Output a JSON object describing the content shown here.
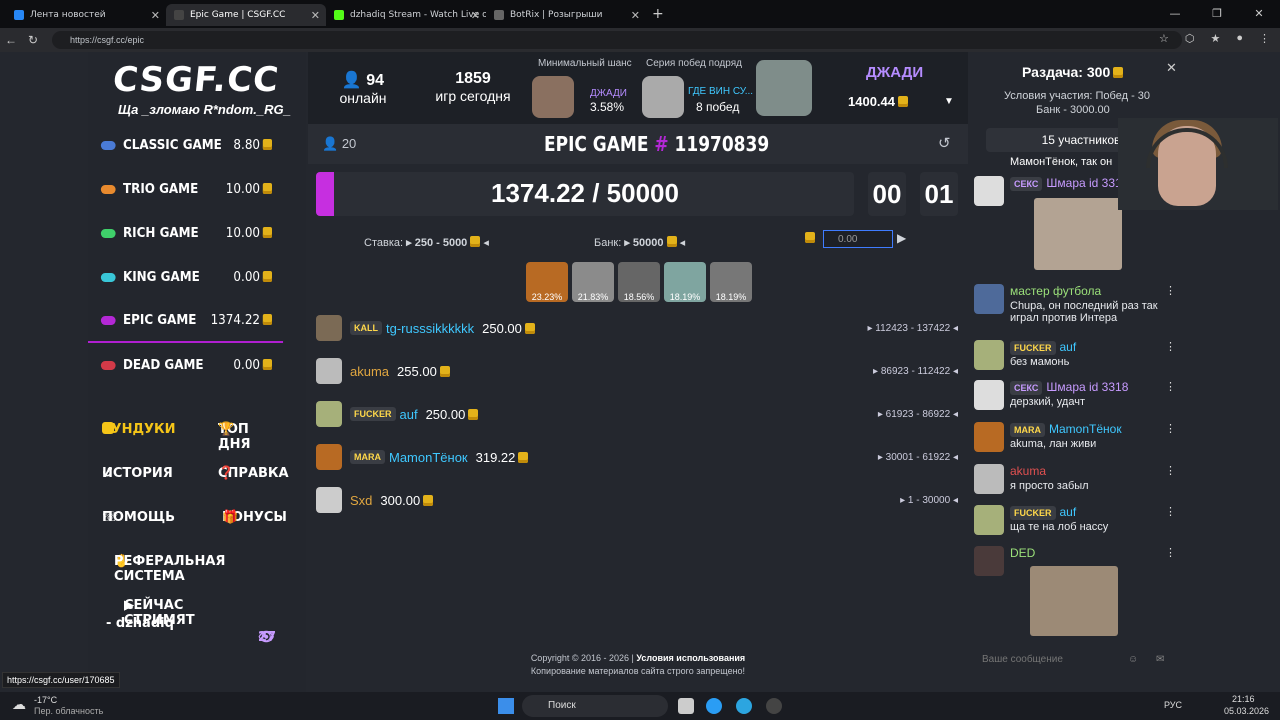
{
  "tabs": [
    {
      "label": "Лента новостей",
      "color": "#2787f5"
    },
    {
      "label": "Epic Game | CSGF.CC",
      "color": "#333"
    },
    {
      "label": "dzhadiq Stream - Watch Live on Ki",
      "color": "#53fc18"
    },
    {
      "label": "BotRix | Розыгрыши",
      "color": "#222"
    }
  ],
  "url": "https://csgf.cc/epic",
  "logo": "CSGF.CC",
  "slogan": "Ща _зломаю R*ndom._RG_",
  "games": [
    {
      "name": "CLASSIC GAME",
      "value": "8.80",
      "color": "#4a7bd6"
    },
    {
      "name": "TRIO GAME",
      "value": "10.00",
      "color": "#e88a2e"
    },
    {
      "name": "RICH GAME",
      "value": "10.00",
      "color": "#3fd06a"
    },
    {
      "name": "KING GAME",
      "value": "0.00",
      "color": "#39c7d8"
    },
    {
      "name": "EPIC GAME",
      "value": "1374.22",
      "color": "#b428d6"
    },
    {
      "name": "DEAD GAME",
      "value": "0.00",
      "color": "#d23a48"
    }
  ],
  "menu": {
    "chests": "СУНДУКИ",
    "top": "ТОП ДНЯ",
    "history": "ИСТОРИЯ",
    "help": "СПРАВКА",
    "support": "ПОМОЩЬ",
    "bonus": "БОНУСЫ",
    "ref": "РЕФЕРАЛЬНАЯ СИСТЕМА",
    "streaming": "СЕЙЧАС СТРИМЯТ",
    "streamer": "- dzhadiq",
    "viewers": "27"
  },
  "header": {
    "online_count": "94",
    "online_label": "онлайн",
    "games_count": "1859",
    "games_label": "игр сегодня",
    "min_chance_label": "Минимальный шанс",
    "min_chance_name": "ДЖАДИ",
    "min_chance_value": "3.58%",
    "streak_label": "Серия побед подряд",
    "streak_name": "ГДЕ ВИН СУ...",
    "streak_value": "8 побед",
    "user_name": "ДЖАДИ",
    "user_balance": "1400.44"
  },
  "game": {
    "players": "20",
    "title_prefix": "EPIC GAME",
    "hash": "#",
    "number": "11970839",
    "pot": "1374.22 / 50000",
    "pot_progress": 0.027,
    "min": "00",
    "sec": "01",
    "bet_label": "Ставка:",
    "bet_range": "250 - 5000",
    "bank_label": "Банк:",
    "bank_value": "50000",
    "input_value": "0.00"
  },
  "chances": [
    "23.23%",
    "21.83%",
    "18.56%",
    "18.19%",
    "18.19%"
  ],
  "players": [
    {
      "tag": "KALL",
      "name": "tg-russsikkkkkk",
      "name_color": "#3fc8ff",
      "amount": "250.00",
      "range": "112423 - 137422",
      "ava": "#7b6a55"
    },
    {
      "tag": "",
      "name": "akuma",
      "name_color": "#e0a640",
      "amount": "255.00",
      "range": "86923 - 112422",
      "ava": "#bbb"
    },
    {
      "tag": "FUCKER",
      "name": "auf",
      "name_color": "#3fc8ff",
      "amount": "250.00",
      "range": "61923 - 86922",
      "ava": "#a6b07a"
    },
    {
      "tag": "MARA",
      "name": "МamonТёнок",
      "name_color": "#3fc8ff",
      "amount": "319.22",
      "range": "30001 - 61922",
      "ava": "#b86a23"
    },
    {
      "tag": "",
      "name": "Sxd",
      "name_color": "#e0a640",
      "amount": "300.00",
      "range": "1 - 30000",
      "ava": "#ccc"
    }
  ],
  "footer": {
    "copyright": "Copyright © 2016 - 2026 | ",
    "terms": "Условия использования",
    "warning": "Копирование материалов сайта строго запрещено!"
  },
  "giveaway": {
    "title": "Раздача: 30",
    "suffix": "0",
    "conditions": "Условия участия: Побед - 30",
    "bank": "Банк - 3000.00",
    "participants": "15 участников"
  },
  "chat": [
    {
      "tag": "",
      "name": "МамонТёнок, так он",
      "text": "",
      "color": "#fff"
    },
    {
      "tag": "СЕКС",
      "name": "Шмара id 331",
      "text": "",
      "color": "#c79bff"
    },
    {
      "tag": "",
      "name": "мастер футбола",
      "text": "Chupa, он последний раз так играл против Интера",
      "color": "#9be07a"
    },
    {
      "tag": "FUCKER",
      "name": "auf",
      "text": "без мамонь",
      "color": "#3fc8ff"
    },
    {
      "tag": "СЕКС",
      "name": "Шмара id 3318",
      "text": "дерзкий, удачт",
      "color": "#c79bff"
    },
    {
      "tag": "MARA",
      "name": "МamonТёнок",
      "text": "akuma, лан живи",
      "color": "#3fc8ff"
    },
    {
      "tag": "",
      "name": "akuma",
      "text": "я просто забыл",
      "color": "#e05050"
    },
    {
      "tag": "FUCKER",
      "name": "auf",
      "text": "ща те на лоб нассу",
      "color": "#3fc8ff"
    },
    {
      "tag": "",
      "name": "DED",
      "text": "",
      "color": "#9be07a"
    }
  ],
  "chat_placeholder": "Ваше сообщение",
  "hover_url": "https://csgf.cc/user/170685",
  "taskbar": {
    "temp": "-17°C",
    "weather": "Пер. облачность",
    "search": "Поиск",
    "lang": "РУС",
    "time": "21:16",
    "date": "05.03.2026"
  }
}
